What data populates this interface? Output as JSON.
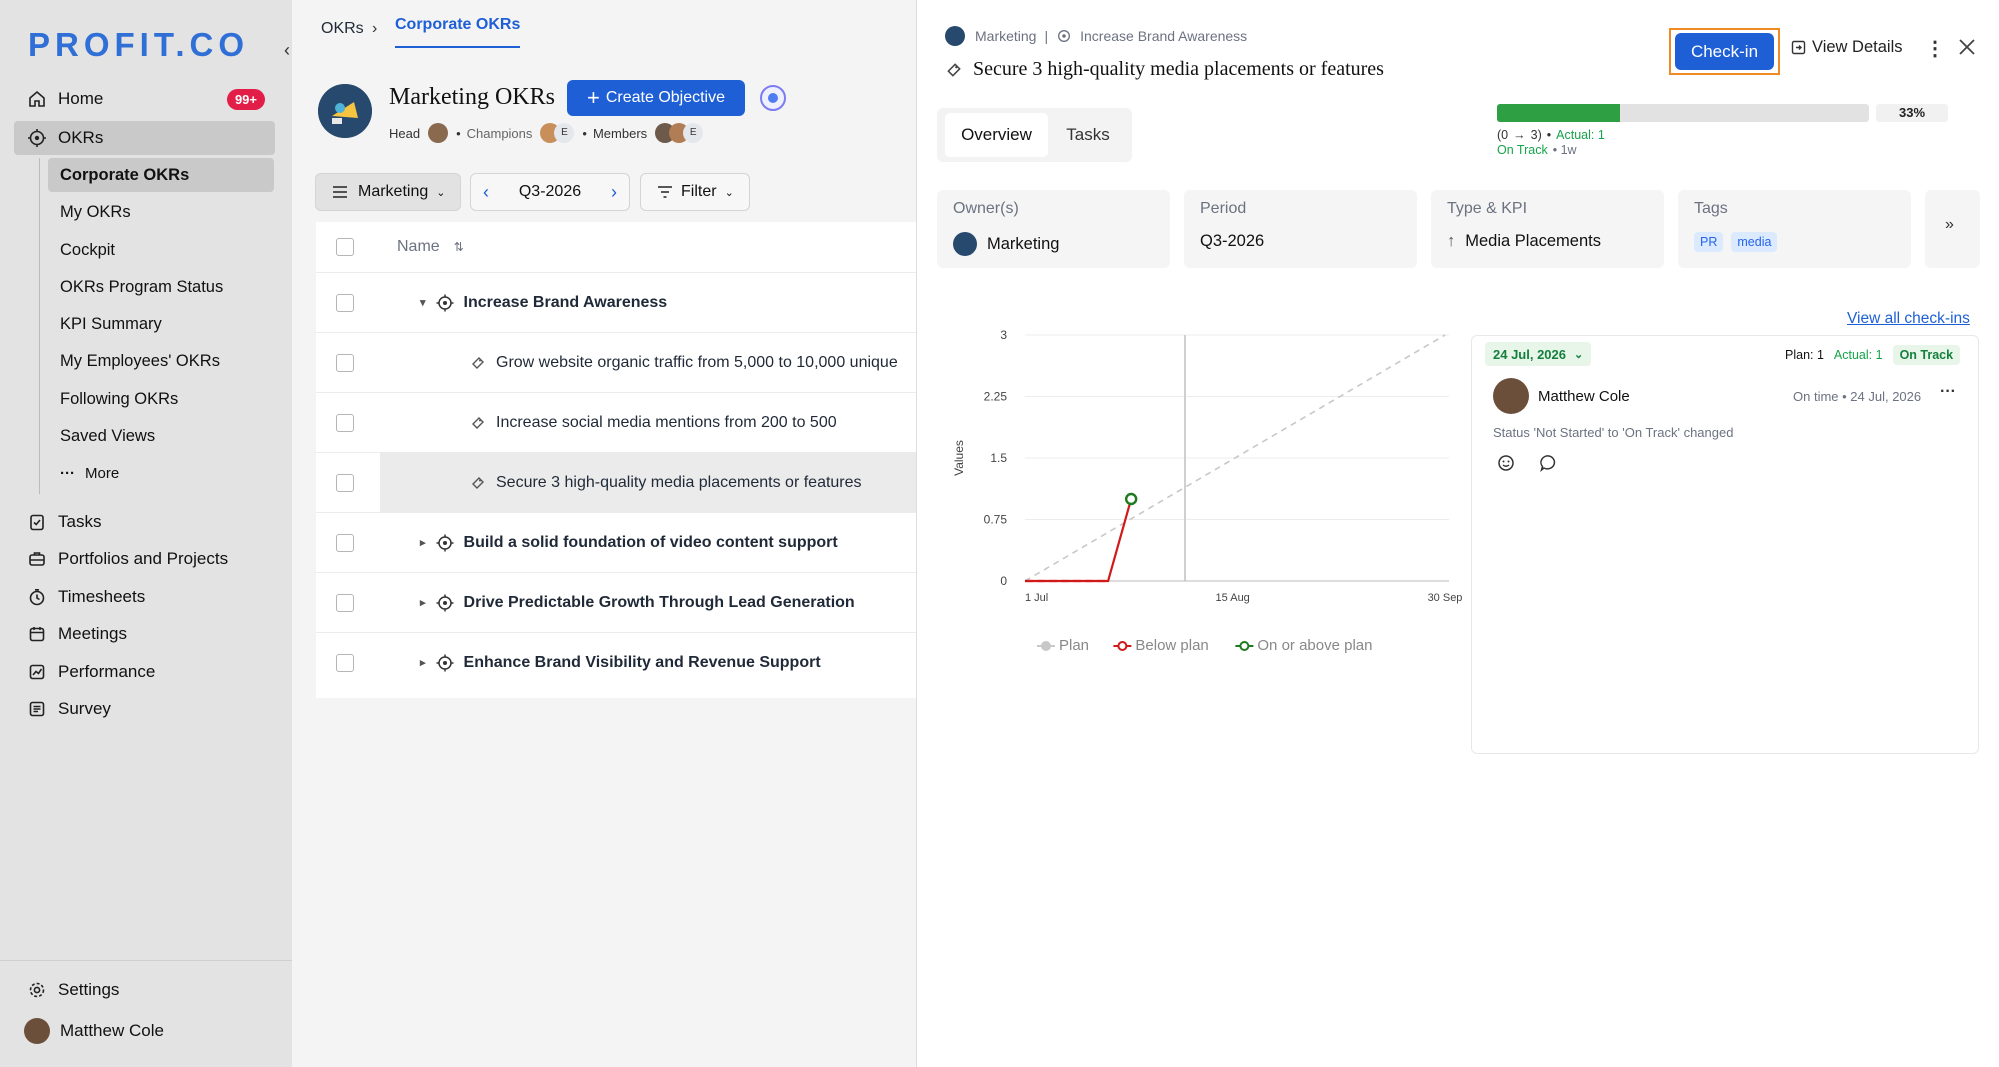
{
  "brand": {
    "logo": "PROFIT.CO",
    "accent": "#1e5fd6",
    "success": "#16a34a",
    "danger": "#e11d48"
  },
  "sidebar": {
    "items": [
      {
        "label": "Home",
        "icon": "home-icon",
        "badge": "99+"
      },
      {
        "label": "OKRs",
        "icon": "target-icon"
      }
    ],
    "sub_items": [
      {
        "label": "Corporate OKRs"
      },
      {
        "label": "My OKRs"
      },
      {
        "label": "Cockpit"
      },
      {
        "label": "OKRs Program Status"
      },
      {
        "label": "KPI Summary"
      },
      {
        "label": "My Employees' OKRs"
      },
      {
        "label": "Following OKRs"
      },
      {
        "label": "Saved Views"
      },
      {
        "label": "More"
      }
    ],
    "items2": [
      {
        "label": "Tasks",
        "icon": "task-icon"
      },
      {
        "label": "Portfolios and Projects",
        "icon": "briefcase-icon"
      },
      {
        "label": "Timesheets",
        "icon": "clock-icon"
      },
      {
        "label": "Meetings",
        "icon": "calendar-icon"
      },
      {
        "label": "Performance",
        "icon": "chart-icon"
      },
      {
        "label": "Survey",
        "icon": "survey-icon"
      }
    ],
    "settings": "Settings",
    "user": "Matthew Cole"
  },
  "middle": {
    "breadcrumb": {
      "root": "OKRs",
      "current": "Corporate OKRs"
    },
    "title": "Marketing OKRs",
    "create_label": "Create Objective",
    "roles": {
      "head": "Head",
      "champions": "Champions",
      "members": "Members",
      "initial": "E"
    },
    "filters": {
      "team": "Marketing",
      "period": "Q3-2026",
      "filter": "Filter"
    },
    "table": {
      "name_header": "Name",
      "rows": [
        {
          "label": "Increase Brand Awareness",
          "type": "objective",
          "expanded": true
        },
        {
          "label": "Grow website organic traffic from 5,000 to 10,000 unique",
          "type": "kr"
        },
        {
          "label": "Increase social media mentions from 200 to 500",
          "type": "kr"
        },
        {
          "label": "Secure 3 high-quality media placements or features",
          "type": "kr",
          "selected": true
        },
        {
          "label": "Build a solid foundation of video content support",
          "type": "objective"
        },
        {
          "label": "Drive Predictable Growth Through Lead Generation",
          "type": "objective"
        },
        {
          "label": "Enhance Brand Visibility and Revenue Support",
          "type": "objective"
        }
      ]
    }
  },
  "drawer": {
    "breadcrumb": {
      "team": "Marketing",
      "separator": "|",
      "objective": "Increase Brand Awareness"
    },
    "title": "Secure 3 high-quality media placements or features",
    "checkin_label": "Check-in",
    "view_details_label": "View Details",
    "progress": {
      "percent_label": "33%",
      "fraction": 0.33,
      "range": "(0",
      "arrow": "→",
      "target": "3)",
      "actual": "Actual: 1",
      "status": "On Track",
      "period": "• 1w"
    },
    "tabs": [
      {
        "label": "Overview",
        "active": true
      },
      {
        "label": "Tasks"
      }
    ],
    "cards": {
      "owner": {
        "label": "Owner(s)",
        "value": "Marketing"
      },
      "period": {
        "label": "Period",
        "value": "Q3-2026"
      },
      "kpi": {
        "label": "Type & KPI",
        "value": "Media Placements"
      },
      "tags": {
        "label": "Tags",
        "values": [
          "PR",
          "media"
        ]
      }
    },
    "checkins": {
      "view_all": "View all check-ins",
      "date": "24 Jul, 2026",
      "plan": "Plan: 1",
      "actual": "Actual: 1",
      "status": "On Track",
      "user": "Matthew Cole",
      "timing": "On time • 24 Jul, 2026",
      "note": "Status 'Not Started' to 'On Track' changed"
    }
  },
  "chart_data": {
    "type": "line",
    "ylabel": "Values",
    "y_ticks": [
      "3",
      "2.25",
      "1.5",
      "0.75",
      "0"
    ],
    "x_ticks": [
      "1 Jul",
      "15 Aug",
      "30 Sep"
    ],
    "ylim": [
      0,
      3
    ],
    "series": [
      {
        "name": "Plan",
        "color": "#c8c8c8",
        "style": "dashed",
        "points": [
          [
            "1 Jul",
            0
          ],
          [
            "30 Sep",
            3
          ]
        ]
      },
      {
        "name": "Below plan",
        "color": "#d11919",
        "points": [
          [
            "1 Jul",
            0
          ],
          [
            "19 Jul",
            0
          ],
          [
            "24 Jul",
            1
          ]
        ]
      },
      {
        "name": "On or above plan",
        "color": "#1f7a1f",
        "points": [
          [
            "24 Jul",
            1
          ]
        ]
      }
    ],
    "legend": [
      "Plan",
      "Below plan",
      "On or above plan"
    ],
    "legend_position": "bottom"
  }
}
